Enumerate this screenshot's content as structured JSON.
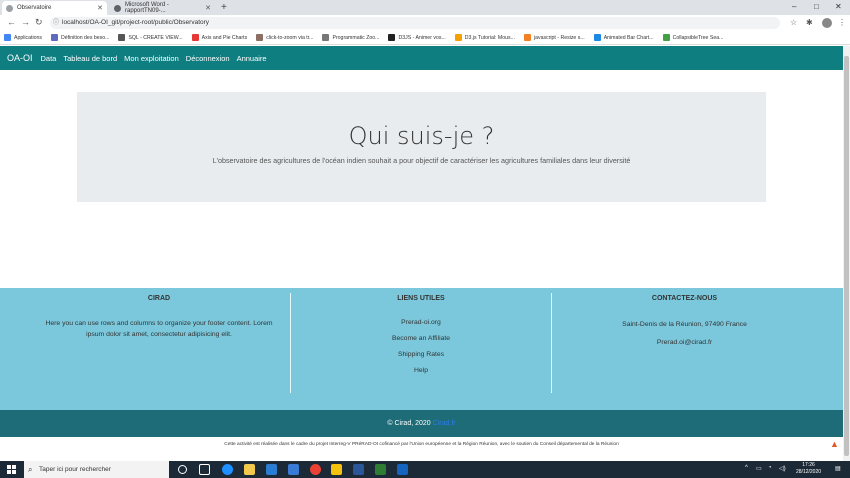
{
  "browser": {
    "tabs": [
      {
        "title": "Observatoire",
        "active": true
      },
      {
        "title": "Microsoft Word - rapportTN09-...",
        "active": false
      }
    ],
    "url": "localhost/OA-OI_git/project-root/public/Observatory",
    "bookmarks": [
      {
        "label": "Applications",
        "color": "#4285f4"
      },
      {
        "label": "Définition des beso...",
        "color": "#5c6bc0"
      },
      {
        "label": "SQL - CREATE VIEW...",
        "color": "#555555"
      },
      {
        "label": "Axis and Pie Charts",
        "color": "#e53935"
      },
      {
        "label": "click-to-zoom via tr...",
        "color": "#8d6e63"
      },
      {
        "label": "Programmatic Zoo...",
        "color": "#777777"
      },
      {
        "label": "D3JS - Animer vos...",
        "color": "#222222"
      },
      {
        "label": "D3.js Tutorial: Mous...",
        "color": "#f4a100"
      },
      {
        "label": "javascript - Resize s...",
        "color": "#f48024"
      },
      {
        "label": "Animated Bar Chart...",
        "color": "#1e88e5"
      },
      {
        "label": "CollapsibleTree Sea...",
        "color": "#43a047"
      }
    ]
  },
  "nav": {
    "brand": "OA-OI",
    "links": [
      "Data",
      "Tableau de bord",
      "Mon exploitation",
      "Déconnexion",
      "Annuaire"
    ]
  },
  "hero": {
    "title": "Qui suis-je ?",
    "text": "L'observatoire des agricultures de l'océan indien souhait a pour objectif de caractériser les agricultures familiales dans leur diversité"
  },
  "footer": {
    "col1": {
      "title": "CIRAD",
      "text": "Here you can use rows and columns to organize your footer content. Lorem ipsum dolor sit amet, consectetur adipisicing elit."
    },
    "col2": {
      "title": "LIENS UTILES",
      "links": [
        "Prerad-oi.org",
        "Become an Affiliate",
        "Shipping Rates",
        "Help"
      ]
    },
    "col3": {
      "title": "CONTACTEZ-NOUS",
      "address": "Saint-Denis de la Réunion, 97490 France",
      "email": "Prerad.oi@cirad.fr"
    },
    "copyright": "© Cirad, 2020",
    "copyright_link": "Cirad.fr",
    "legal": "Cette activité est réalisée dans le cadre du projet Interreg-V PRéRAD-OI cofinancé par l'Union européenne et la Région Réunion, avec le soutien du Conseil départemental de la Réunion"
  },
  "taskbar": {
    "search_placeholder": "Taper ici pour rechercher",
    "time": "17:26",
    "date": "28/12/2020"
  },
  "colors": {
    "nav": "#0f7e81",
    "footer": "#7bc8dc",
    "copybar": "#1e6c77",
    "hero": "#e9ecef"
  }
}
